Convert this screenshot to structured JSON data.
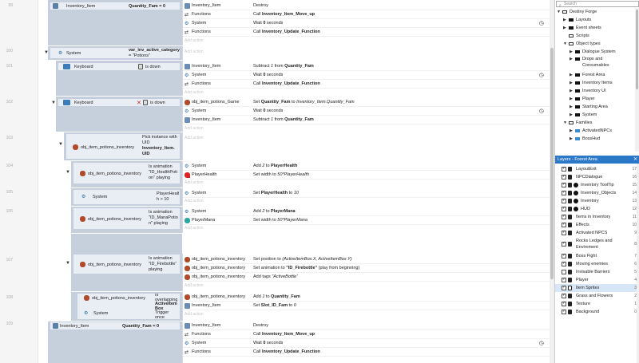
{
  "line_numbers": [
    "99",
    "100",
    "101",
    "102",
    "103",
    "104",
    "105",
    "106",
    "107",
    "108",
    "109"
  ],
  "add_action_label": "Add action",
  "events": {
    "e99": {
      "cond": {
        "object": "Inventory_Item",
        "expr": "Quantity_Fam = 0"
      },
      "actions": [
        {
          "obj": "Inventory_Item",
          "text": "Destroy"
        },
        {
          "obj": "Functions",
          "pre": "Call ",
          "bold": "Inventory_Item_Move_up"
        },
        {
          "obj": "System",
          "pre": "Wait ",
          "bold": "0",
          "post": " seconds"
        },
        {
          "obj": "Functions",
          "pre": "Call ",
          "bold": "Inventory_Update_Function"
        }
      ]
    },
    "e100": {
      "cond": {
        "object": "System",
        "expr": "var_inv_active_category",
        "expr2": "= \"Potions\""
      }
    },
    "e101": {
      "cond": {
        "object": "Keyboard",
        "expr": "is down"
      },
      "actions": [
        {
          "obj": "Inventory_Item",
          "pre": "Subtract ",
          "it": "1",
          "mid": " from ",
          "bold": "Quantity_Fam"
        },
        {
          "obj": "System",
          "pre": "Wait ",
          "bold": "0",
          "post": " seconds"
        },
        {
          "obj": "Functions",
          "pre": "Call ",
          "bold": "Inventory_Update_Function"
        }
      ]
    },
    "e102": {
      "cond": {
        "object": "Keyboard",
        "expr": "is down"
      },
      "actions": [
        {
          "obj": "obj_item_potions_Game",
          "pre": "Set ",
          "bold": "Quantity_Fam",
          "mid": " to ",
          "it": "Inventory_Item.Quantity_Fam"
        },
        {
          "obj": "System",
          "pre": "Wait ",
          "bold": "0",
          "post": " seconds"
        },
        {
          "obj": "Inventory_Item",
          "pre": "Subtract ",
          "it": "1",
          "mid": " from ",
          "bold": "Quantity_Fam"
        }
      ]
    },
    "e103": {
      "cond": {
        "object": "obj_item_potions_inventory",
        "line1": "Pick instance with",
        "line2": "UID",
        "line3": "Inventory_Item.",
        "line4": "UID"
      }
    },
    "e104": {
      "cond": {
        "object": "obj_item_potions_inventory",
        "line1": "Is animation",
        "line2": "\"ID_HealthPoti",
        "line3": "on\" playing"
      },
      "actions": [
        {
          "obj": "System",
          "pre": "Add ",
          "it": "2",
          "mid": " to ",
          "bold": "PlayerHealth"
        },
        {
          "obj": "PlayerHealth",
          "pre": "Set width to ",
          "it": "50*PlayerHealth"
        }
      ]
    },
    "e105": {
      "cond": {
        "object": "System",
        "line1": "PlayerHealt",
        "line2": "h > 10"
      },
      "actions": [
        {
          "obj": "System",
          "pre": "Set ",
          "bold": "PlayerHealth",
          "mid": " to ",
          "it": "10"
        }
      ]
    },
    "e106": {
      "cond": {
        "object": "obj_item_potions_inventory",
        "line1": "Is animation",
        "line2": "\"ID_ManaPotio",
        "line3": "n\" playing"
      },
      "actions": [
        {
          "obj": "System",
          "pre": "Add ",
          "it": "2",
          "mid": " to ",
          "bold": "PlayerMana"
        },
        {
          "obj": "PlayerMana",
          "pre": "Set width to ",
          "it": "50*PlayerMana"
        }
      ]
    },
    "e107": {
      "cond": {
        "object": "obj_item_potions_inventory",
        "line1": "Is animation",
        "line2": "\"ID_Firebottle\"",
        "line3": "playing"
      },
      "actions": [
        {
          "obj": "obj_item_potions_inventory",
          "pre": "Set position to ",
          "it": "(ActiveItemBox.X, ActiveItemBox.Y)"
        },
        {
          "obj": "obj_item_potions_inventory",
          "pre": "Set animation to ",
          "bold": "\"ID_Firebottle\"",
          "post": " (play from beginning)"
        },
        {
          "obj": "obj_item_potions_inventory",
          "pre": "Add tags ",
          "it": "\"ActiveBottle\""
        }
      ]
    },
    "e108": {
      "cond": {
        "object": "obj_item_potions_inventory",
        "line1": "Is",
        "line2": "overlapping",
        "line3": "ActiveItem",
        "line4": "Box",
        "object2": "System",
        "line5": "Trigger",
        "line6": "once"
      },
      "actions": [
        {
          "obj": "obj_item_potions_inventory",
          "pre": "Add ",
          "it": "1",
          "mid": " to ",
          "bold": "Quantity_Fam"
        },
        {
          "obj": "Inventory_Item",
          "pre": "Set ",
          "bold": "Slot_ID_Fam",
          "mid": " to ",
          "it": "0"
        }
      ]
    },
    "e109": {
      "cond": {
        "object": "Inventory_Item",
        "expr": "Quantity_Fam = 0"
      },
      "actions": [
        {
          "obj": "Inventory_Item",
          "text": "Destroy"
        },
        {
          "obj": "Functions",
          "pre": "Call ",
          "bold": "Inventory_Item_Move_up"
        },
        {
          "obj": "System",
          "pre": "Wait ",
          "bold": "0",
          "post": " seconds"
        },
        {
          "obj": "Functions",
          "pre": "Call ",
          "bold": "Inventory_Update_Function"
        }
      ]
    }
  },
  "project": {
    "search_placeholder": "Search",
    "tree": [
      {
        "label": "Destiny Forge",
        "open": true
      },
      {
        "label": "Layouts"
      },
      {
        "label": "Event sheets"
      },
      {
        "label": "Scripts"
      },
      {
        "label": "Object types",
        "open": true
      },
      {
        "label": "Dialogue System"
      },
      {
        "label": "Drops and",
        "label2": "Consumables"
      },
      {
        "label": "Forest Area"
      },
      {
        "label": "Inventory Items"
      },
      {
        "label": "Inventory UI"
      },
      {
        "label": "Player"
      },
      {
        "label": "Starting Area"
      },
      {
        "label": "System"
      },
      {
        "label": "Families",
        "open": true
      },
      {
        "label": "ActivatedNPCs"
      },
      {
        "label": "BossHud"
      }
    ]
  },
  "layers": {
    "title": "Layers - Forest Area",
    "close": "✕",
    "items": [
      {
        "name": "LayoutExit",
        "num": "17",
        "checked": true,
        "locked": true
      },
      {
        "name": "NPCDialogue",
        "num": "16",
        "checked": true,
        "locked": true
      },
      {
        "name": "Inventory ToolTip",
        "num": "15",
        "checked": true,
        "locked": true,
        "global": true
      },
      {
        "name": "Inventory_Objects",
        "num": "14",
        "checked": true,
        "locked": true,
        "global": true
      },
      {
        "name": "Inventory",
        "num": "13",
        "checked": true,
        "locked": true,
        "global": true
      },
      {
        "name": "HUD",
        "num": "12",
        "checked": true,
        "locked": true,
        "global": true
      },
      {
        "name": "Items in Inventory",
        "num": "11",
        "checked": true,
        "locked": true
      },
      {
        "name": "Effects",
        "num": "10",
        "checked": true,
        "locked": true
      },
      {
        "name": "Activated NPCS",
        "num": "9",
        "checked": true,
        "locked": true
      },
      {
        "name": "Rocks Ledges and",
        "name2": "Enviroment",
        "num": "8",
        "checked": true,
        "locked": true,
        "tall": true
      },
      {
        "name": "Boss Fight",
        "num": "7",
        "checked": true,
        "locked": true
      },
      {
        "name": "Moving enemies",
        "num": "6",
        "checked": true,
        "locked": true
      },
      {
        "name": "Invisable Barriers",
        "num": "5",
        "checked": false,
        "locked": true
      },
      {
        "name": "Player",
        "num": "4",
        "checked": true,
        "locked": true
      },
      {
        "name": "Item Sprites",
        "num": "3",
        "checked": true,
        "locked": false,
        "selected": true
      },
      {
        "name": "Grass and Flowers",
        "num": "2",
        "checked": true,
        "locked": true
      },
      {
        "name": "Texture",
        "num": "1",
        "checked": true,
        "locked": true
      },
      {
        "name": "Background",
        "num": "0",
        "checked": true,
        "locked": true
      }
    ]
  },
  "colors": {
    "accent": "#2b78c8",
    "condition_bg": "#c6cfdc",
    "condition_row": "#e9eef5"
  }
}
